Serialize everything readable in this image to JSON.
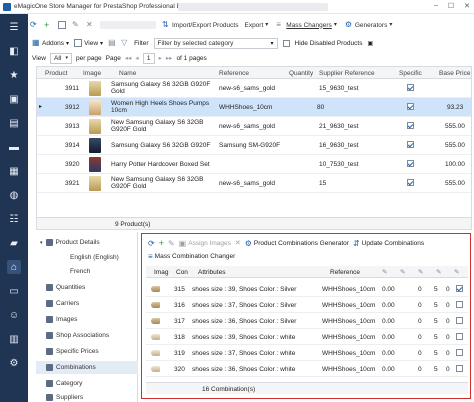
{
  "window": {
    "title": "eMagicOne Store Manager for PrestaShop Professional Edition",
    "controls": [
      "–",
      "☐",
      "✕"
    ]
  },
  "nav": {
    "icons": [
      "menu-icon",
      "dashboard-icon",
      "star-icon",
      "products-icon",
      "orders-icon",
      "messages-icon",
      "categories-icon",
      "globe-icon",
      "settings-sliders-icon",
      "truck-icon",
      "store-icon",
      "drive-icon",
      "people-icon",
      "chart-icon",
      "gear-icon"
    ]
  },
  "toolbar1": {
    "import_export": "Import/Export Products",
    "export": "Export",
    "mass_changers": "Mass Changers",
    "generators": "Generators"
  },
  "toolbar2": {
    "addons": "Addons",
    "view": "View",
    "filter_label": "Filter",
    "filter_placeholder": "Filter by selected category",
    "hide_disabled": "Hide Disabled Products"
  },
  "toolbar3": {
    "view_label": "View",
    "view_value": "All",
    "per_page": "per page",
    "page_label": "Page",
    "page_value": "1",
    "of_pages": "of 1 pages"
  },
  "products": {
    "columns": {
      "id": "Product",
      "image": "Image",
      "name": "Name",
      "reference": "Reference",
      "quantity": "Quantity",
      "supplier_ref": "Supplier Reference",
      "specific": "Specific",
      "base_price": "Base Price"
    },
    "rows": [
      {
        "id": "3911",
        "name": "Samsung Galaxy S6 32GB G920F Gold",
        "reference": "new-s6_sams_gold",
        "quantity": "",
        "supplier_ref": "15_9630_test",
        "specific": true,
        "price": ""
      },
      {
        "id": "3912",
        "name": "Women High Heels Shoes Pumps 10cm",
        "reference": "WHHShoes_10cm",
        "quantity": "80",
        "supplier_ref": "",
        "specific": true,
        "price": "93.23"
      },
      {
        "id": "3913",
        "name": "New Samsung Galaxy S6 32GB G920F Gold",
        "reference": "new-s6_sams_gold",
        "quantity": "",
        "supplier_ref": "21_9630_test",
        "specific": true,
        "price": "555.00"
      },
      {
        "id": "3914",
        "name": "Samsung Galaxy S6 32GB G920F",
        "reference": "Samsung SM-G920F",
        "quantity": "",
        "supplier_ref": "16_9630_test",
        "specific": true,
        "price": "555.00"
      },
      {
        "id": "3920",
        "name": "Harry Potter Hardcover Boxed Set",
        "reference": "",
        "quantity": "",
        "supplier_ref": "10_7530_test",
        "specific": true,
        "price": "100.00"
      },
      {
        "id": "3921",
        "name": "New Samsung Galaxy S6 32GB G920F Gold",
        "reference": "new-s6_sams_gold",
        "quantity": "",
        "supplier_ref": "15",
        "specific": true,
        "price": "555.00"
      }
    ],
    "footer": "9 Product(s)"
  },
  "details": {
    "root": "Product Details",
    "items": [
      "English (English)",
      "French",
      "Quantities",
      "Carriers",
      "Images",
      "Shop Associations",
      "Specific Prices",
      "Combinations",
      "Category",
      "Suppliers"
    ],
    "selected": "Combinations"
  },
  "combinations": {
    "toolbar": {
      "assign_images": "Assign Images",
      "generator": "Product Combinations Generator",
      "update": "Update Combinations",
      "mass_changer": "Mass Combination Changer"
    },
    "columns": {
      "image": "Imag",
      "con": "Con",
      "attributes": "Attributes",
      "reference": "Reference"
    },
    "rows": [
      {
        "con": "315",
        "attributes": "shoes size : 39, Shoes Color : Silver",
        "reference": "WHHShoes_10cm",
        "v1": "0.00",
        "v2": "0",
        "v3": "5",
        "v4": "0",
        "checked": true
      },
      {
        "con": "316",
        "attributes": "shoes size : 37, Shoes Color : Silver",
        "reference": "WHHShoes_10cm",
        "v1": "0.00",
        "v2": "0",
        "v3": "5",
        "v4": "0",
        "checked": false
      },
      {
        "con": "317",
        "attributes": "shoes size : 36, Shoes Color : Silver",
        "reference": "WHHShoes_10cm",
        "v1": "0.00",
        "v2": "0",
        "v3": "5",
        "v4": "0",
        "checked": false
      },
      {
        "con": "318",
        "attributes": "shoes size : 39, Shoes Color : white",
        "reference": "WHHShoes_10cm",
        "v1": "0.00",
        "v2": "0",
        "v3": "5",
        "v4": "0",
        "checked": false
      },
      {
        "con": "319",
        "attributes": "shoes size : 37, Shoes Color : white",
        "reference": "WHHShoes_10cm",
        "v1": "0.00",
        "v2": "0",
        "v3": "5",
        "v4": "0",
        "checked": false
      },
      {
        "con": "320",
        "attributes": "shoes size : 36, Shoes Color : white",
        "reference": "WHHShoes_10cm",
        "v1": "0.00",
        "v2": "0",
        "v3": "5",
        "v4": "0",
        "checked": false
      }
    ],
    "footer": "16 Combination(s)"
  },
  "colors": {
    "nav_bg": "#1f3553",
    "selection": "#cfe4fb",
    "highlight_frame": "#d12f2f",
    "accent": "#1f5fa8"
  }
}
